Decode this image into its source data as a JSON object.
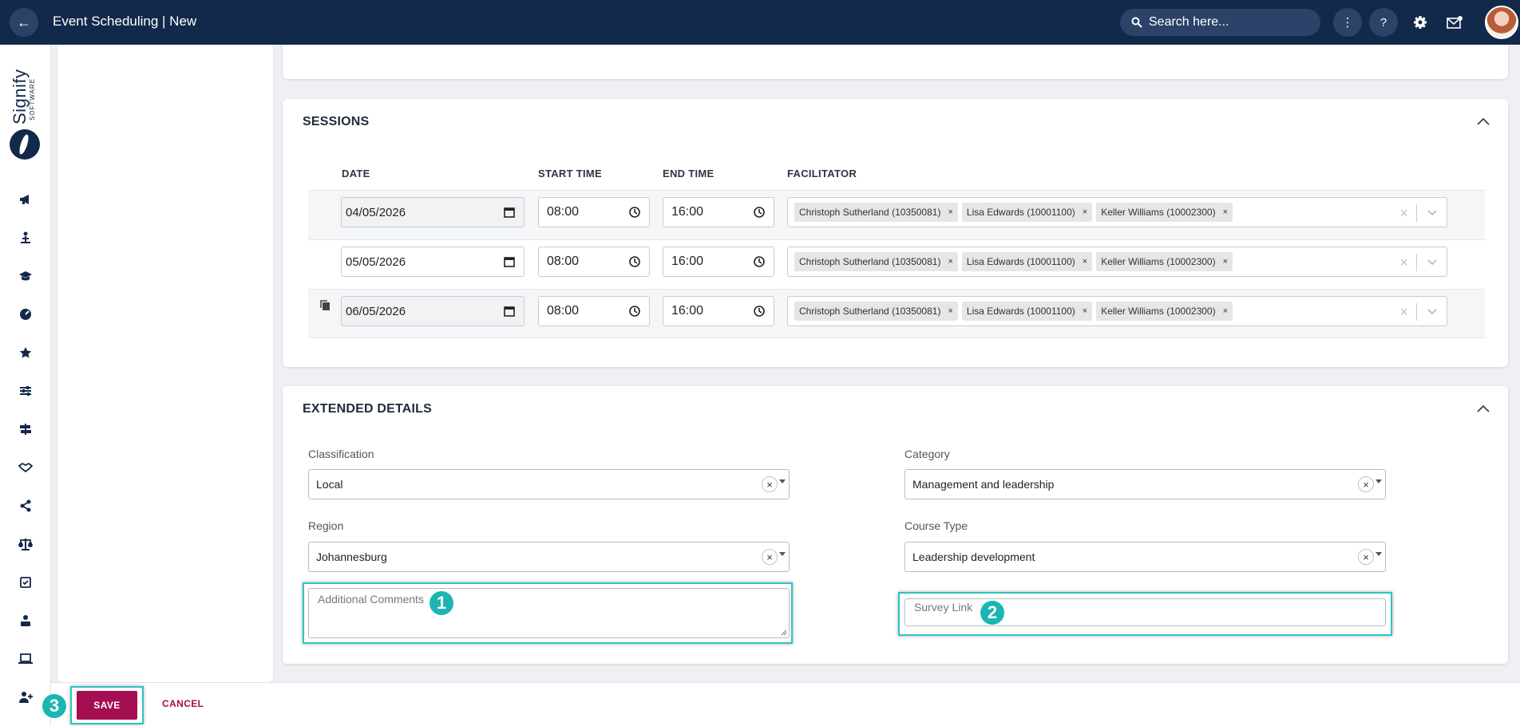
{
  "header": {
    "title": "Event Scheduling | New",
    "search_placeholder": "Search here..."
  },
  "logo": {
    "name": "Signify",
    "sub": "SOFTWARE"
  },
  "sessions": {
    "title": "SESSIONS",
    "columns": {
      "date": "DATE",
      "start": "START TIME",
      "end": "END TIME",
      "facilitator": "FACILITATOR"
    },
    "rows": [
      {
        "date": "04/05/2026",
        "start": "08:00",
        "end": "16:00",
        "facilitators": [
          "Christoph Sutherland (10350081)",
          "Lisa Edwards (10001100)",
          "Keller Williams (10002300)"
        ]
      },
      {
        "date": "05/05/2026",
        "start": "08:00",
        "end": "16:00",
        "facilitators": [
          "Christoph Sutherland (10350081)",
          "Lisa Edwards (10001100)",
          "Keller Williams (10002300)"
        ]
      },
      {
        "date": "06/05/2026",
        "start": "08:00",
        "end": "16:00",
        "facilitators": [
          "Christoph Sutherland (10350081)",
          "Lisa Edwards (10001100)",
          "Keller Williams (10002300)"
        ]
      }
    ],
    "chip_remove": "×",
    "clear": "×"
  },
  "extended": {
    "title": "EXTENDED DETAILS",
    "classification": {
      "label": "Classification",
      "value": "Local"
    },
    "category": {
      "label": "Category",
      "value": "Management and leadership"
    },
    "region": {
      "label": "Region",
      "value": "Johannesburg"
    },
    "course_type": {
      "label": "Course Type",
      "value": "Leadership development"
    },
    "additional_comments": {
      "placeholder": "Additional Comments"
    },
    "survey_link": {
      "placeholder": "Survey Link"
    },
    "clear": "×"
  },
  "callouts": [
    "1",
    "2",
    "3"
  ],
  "footer": {
    "save": "SAVE",
    "cancel": "CANCEL"
  }
}
